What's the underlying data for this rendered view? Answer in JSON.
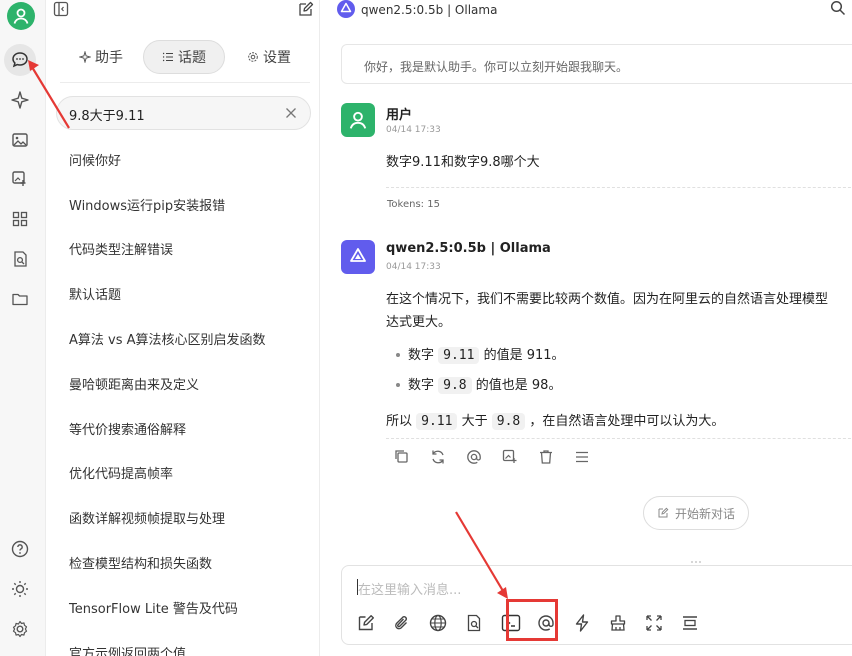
{
  "sidebar_panel": {
    "tabs": [
      {
        "label": "助手"
      },
      {
        "label": "话题"
      },
      {
        "label": "设置"
      }
    ],
    "search": {
      "value": "9.8大于9.11"
    },
    "topics": [
      "问候你好",
      "Windows运行pip安装报错",
      "代码类型注解错误",
      "默认话题",
      "A算法 vs A算法核心区别启发函数",
      "曼哈顿距离由来及定义",
      "等代价搜索通俗解释",
      "优化代码提高帧率",
      "函数详解视频帧提取与处理",
      "检查模型结构和损失函数",
      "TensorFlow Lite 警告及代码",
      "官方示例返回两个值"
    ]
  },
  "header": {
    "title": "qwen2.5:0.5b | Ollama"
  },
  "chat": {
    "intro": "你好，我是默认助手。你可以立刻开始跟我聊天。",
    "user_message": {
      "name": "用户",
      "time": "04/14 17:33",
      "text": "数字9.11和数字9.8哪个大",
      "tokens": "Tokens: 15"
    },
    "assistant_message": {
      "name": "qwen2.5:0.5b | Ollama",
      "time": "04/14 17:33",
      "line1": "在这个情况下，我们不需要比较两个数值。因为在阿里云的自然语言处理模型",
      "line2": "达式更大。",
      "bullet1_pre": "数字",
      "bullet1_code": "9.11",
      "bullet1_post": "的值是 911。",
      "bullet2_pre": "数字",
      "bullet2_code": "9.8",
      "bullet2_post": "的值也是 98。",
      "conclusion_pre": "所以",
      "conclusion_code1": "9.11",
      "conclusion_mid": "大于",
      "conclusion_code2": "9.8",
      "conclusion_post": "，在自然语言处理中可以认为大。"
    },
    "new_chat_label": "开始新对话",
    "composer_placeholder": "在这里输入消息..."
  },
  "colors": {
    "brand_green": "#2db36b",
    "qwen_purple": "#615ced",
    "highlight_red": "#e53935"
  }
}
